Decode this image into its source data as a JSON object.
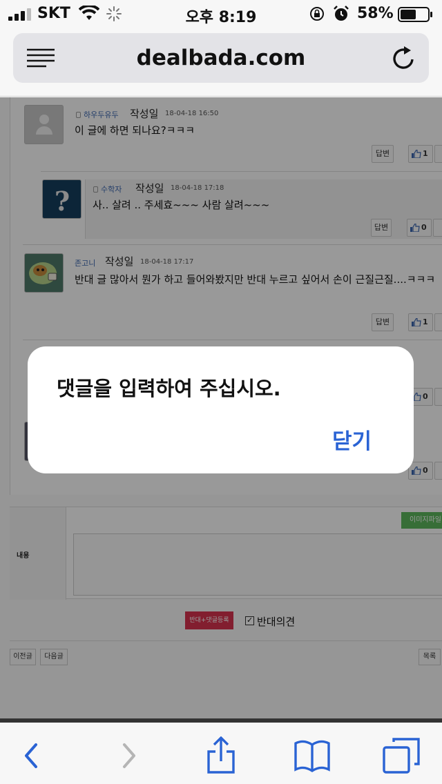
{
  "status_bar": {
    "carrier": "SKT",
    "time": "오후 8:19",
    "battery_percent": "58%",
    "battery_level": 0.58
  },
  "browser": {
    "url": "dealbada.com"
  },
  "comments": [
    {
      "author": "하우두유두",
      "label": "작성일",
      "date": "18-04-18 16:50",
      "text": "이 글에 하면 되나요?ㅋㅋㅋ",
      "reply_label": "답변",
      "likes": "1"
    },
    {
      "author": "수학자",
      "label": "작성일",
      "date": "18-04-18 17:18",
      "text": "사.. 살려 .. 주세효~~~ 사람 살려~~~",
      "reply_label": "답변",
      "likes": "0"
    },
    {
      "author": "존고니",
      "label": "작성일",
      "date": "18-04-18 17:17",
      "text": "반대 글 많아서 뭔가 하고 들어와봤지만 반대 누르고 싶어서 손이 근질근질....ㅋㅋㅋ",
      "reply_label": "답변",
      "likes": "1"
    },
    {
      "likes": "0"
    },
    {
      "likes": "0"
    }
  ],
  "form": {
    "content_label": "내용",
    "image_button": "이미지파일",
    "submit_button": "반대+댓글등록",
    "opinion_label": "반대의견",
    "opinion_checked": true,
    "prev_button": "이전글",
    "next_button": "다음글",
    "list_button": "목록"
  },
  "alert": {
    "message": "댓글을 입력하여 주십시오.",
    "close_label": "닫기"
  },
  "toolbar": {
    "items": [
      "back-icon",
      "forward-icon",
      "share-icon",
      "bookmarks-icon",
      "tabs-icon"
    ]
  },
  "colors": {
    "accent": "#2a63d4",
    "submit": "#d9334f",
    "image_button": "#5cb85c"
  }
}
